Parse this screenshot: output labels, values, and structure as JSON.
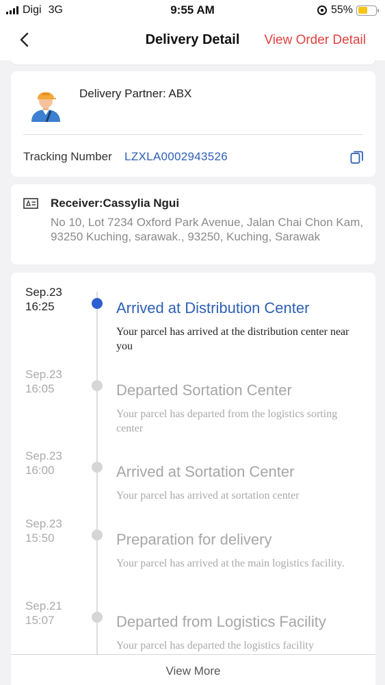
{
  "status_bar": {
    "carrier": "Digi",
    "network": "3G",
    "time": "9:55 AM",
    "battery": "55%",
    "battery_level": 0.55
  },
  "nav": {
    "title": "Delivery Detail",
    "action": "View Order Detail"
  },
  "partner": {
    "name": "Delivery Partner: ABX",
    "tracking_label": "Tracking Number",
    "tracking_number": "LZXLA0002943526"
  },
  "receiver": {
    "name": "Receiver:Cassylia Ngui",
    "address": "No 10, Lot 7234 Oxford Park Avenue, Jalan Chai Chon Kam, 93250 Kuching, sarawak., 93250, Kuching, Sarawak"
  },
  "timeline": {
    "events": [
      {
        "date": "Sep.23",
        "time": "16:25",
        "title": "Arrived at Distribution Center",
        "desc": "Your parcel has arrived at the distribution center near you",
        "active": true
      },
      {
        "date": "Sep.23",
        "time": "16:05",
        "title": "Departed Sortation Center",
        "desc": "Your parcel has departed from the logistics sorting center",
        "active": false
      },
      {
        "date": "Sep.23",
        "time": "16:00",
        "title": "Arrived at Sortation Center",
        "desc": "Your parcel has arrived at sortation center",
        "active": false
      },
      {
        "date": "Sep.23",
        "time": "15:50",
        "title": "Preparation for delivery",
        "desc": "Your parcel has arrived at the main logistics facility.",
        "active": false
      },
      {
        "date": "Sep.21",
        "time": "15:07",
        "title": "Departed from Logistics Facility",
        "desc": "Your parcel has departed the logistics facility",
        "active": false
      }
    ],
    "view_more": "View More"
  },
  "colors": {
    "accent_red": "#e0423f",
    "link_blue": "#2d5fb5",
    "active_dot": "#2d5fcf",
    "inactive_gray": "#a6a6a6"
  },
  "icons": [
    "back-chevron-icon",
    "screen-rotation-lock-icon",
    "battery-icon",
    "signal-icon",
    "courier-avatar-icon",
    "copy-icon",
    "id-card-icon"
  ]
}
